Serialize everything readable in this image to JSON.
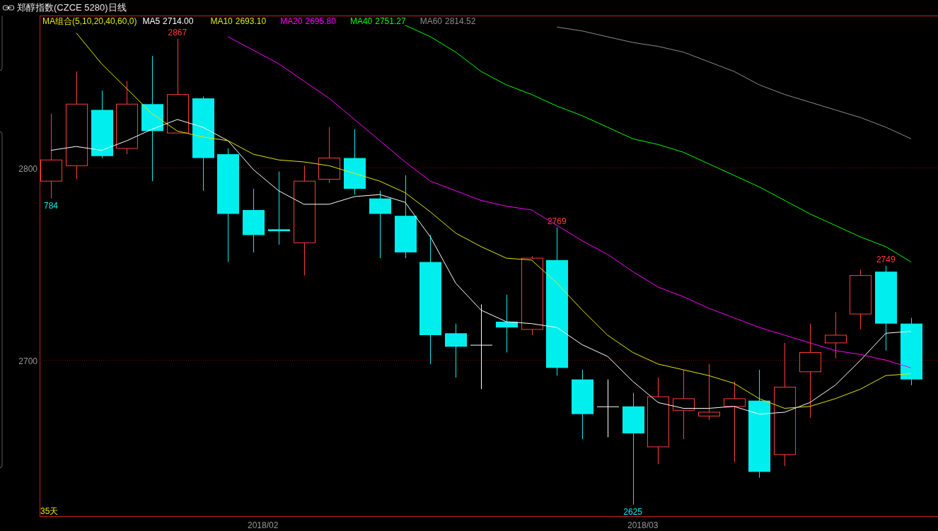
{
  "window": {
    "title": "郑醇指数(CZCE 5280)日线"
  },
  "chart": {
    "legend_title": "MA组合(5,10,20,40,60,0)",
    "legend_values": [
      "2714.00",
      "2693.10",
      "2695.80",
      "2751.27",
      "2814.52"
    ],
    "period": "35天",
    "price_labels": [
      {
        "text": "784",
        "kind": "low"
      },
      {
        "text": "2867",
        "kind": "high"
      },
      {
        "text": "2769",
        "kind": "high"
      },
      {
        "text": "2625",
        "kind": "low"
      },
      {
        "text": "2749",
        "kind": "high"
      }
    ],
    "month_labels": [
      "2018/02",
      "2018/03"
    ],
    "chart_data": {
      "type": "line",
      "ylim": [
        2619,
        2879
      ],
      "yticks": [
        2700,
        2800
      ],
      "series": [
        {
          "name": "MA5",
          "color": "#ffffff",
          "values": [
            2809,
            2811,
            2809,
            2814,
            2820,
            2825,
            2821,
            2814,
            2799,
            2788,
            2781,
            2781,
            2785,
            2786,
            2782,
            2764,
            2740,
            2726,
            2720,
            2719,
            2717,
            2708,
            2702,
            2689,
            2678,
            2675,
            2675,
            2676,
            2672,
            2673,
            2678,
            2687,
            2700,
            2714,
            2715
          ]
        },
        {
          "name": "MA10",
          "color": "#e6e600",
          "values": [
            null,
            2870,
            2854,
            2841,
            2828,
            2819,
            2816,
            2814,
            2807,
            2804,
            2803,
            2801,
            2797,
            2793,
            2787,
            2777,
            2766,
            2759,
            2753,
            2752,
            2740,
            2726,
            2713,
            2704,
            2698,
            2695,
            2692,
            2688,
            2680,
            2675,
            2676,
            2680,
            2685,
            2692,
            2693
          ]
        },
        {
          "name": "MA20",
          "color": "#ff00ff",
          "values": [
            null,
            null,
            null,
            null,
            null,
            null,
            null,
            2868,
            2861,
            2854,
            2845,
            2836,
            2825,
            2814,
            2803,
            2793,
            2788,
            2783,
            2780,
            2778,
            2770,
            2762,
            2755,
            2746,
            2738,
            2733,
            2727,
            2722,
            2717,
            2713,
            2709,
            2705,
            2703,
            2700,
            2696
          ]
        },
        {
          "name": "MA40",
          "color": "#00ff00",
          "values": [
            null,
            null,
            null,
            null,
            null,
            null,
            null,
            null,
            null,
            null,
            null,
            null,
            null,
            null,
            2874,
            2868,
            2860,
            2850,
            2843,
            2838,
            2832,
            2827,
            2821,
            2815,
            2812,
            2808,
            2802,
            2796,
            2790,
            2783,
            2776,
            2770,
            2764,
            2759,
            2751
          ]
        },
        {
          "name": "MA60",
          "color": "#8c8c8c",
          "values": [
            null,
            null,
            null,
            null,
            null,
            null,
            null,
            null,
            null,
            null,
            null,
            null,
            null,
            null,
            null,
            null,
            null,
            null,
            null,
            null,
            2873,
            2871,
            2868,
            2865,
            2863,
            2860,
            2855,
            2850,
            2843,
            2838,
            2834,
            2830,
            2826,
            2821,
            2815
          ]
        }
      ]
    }
  }
}
